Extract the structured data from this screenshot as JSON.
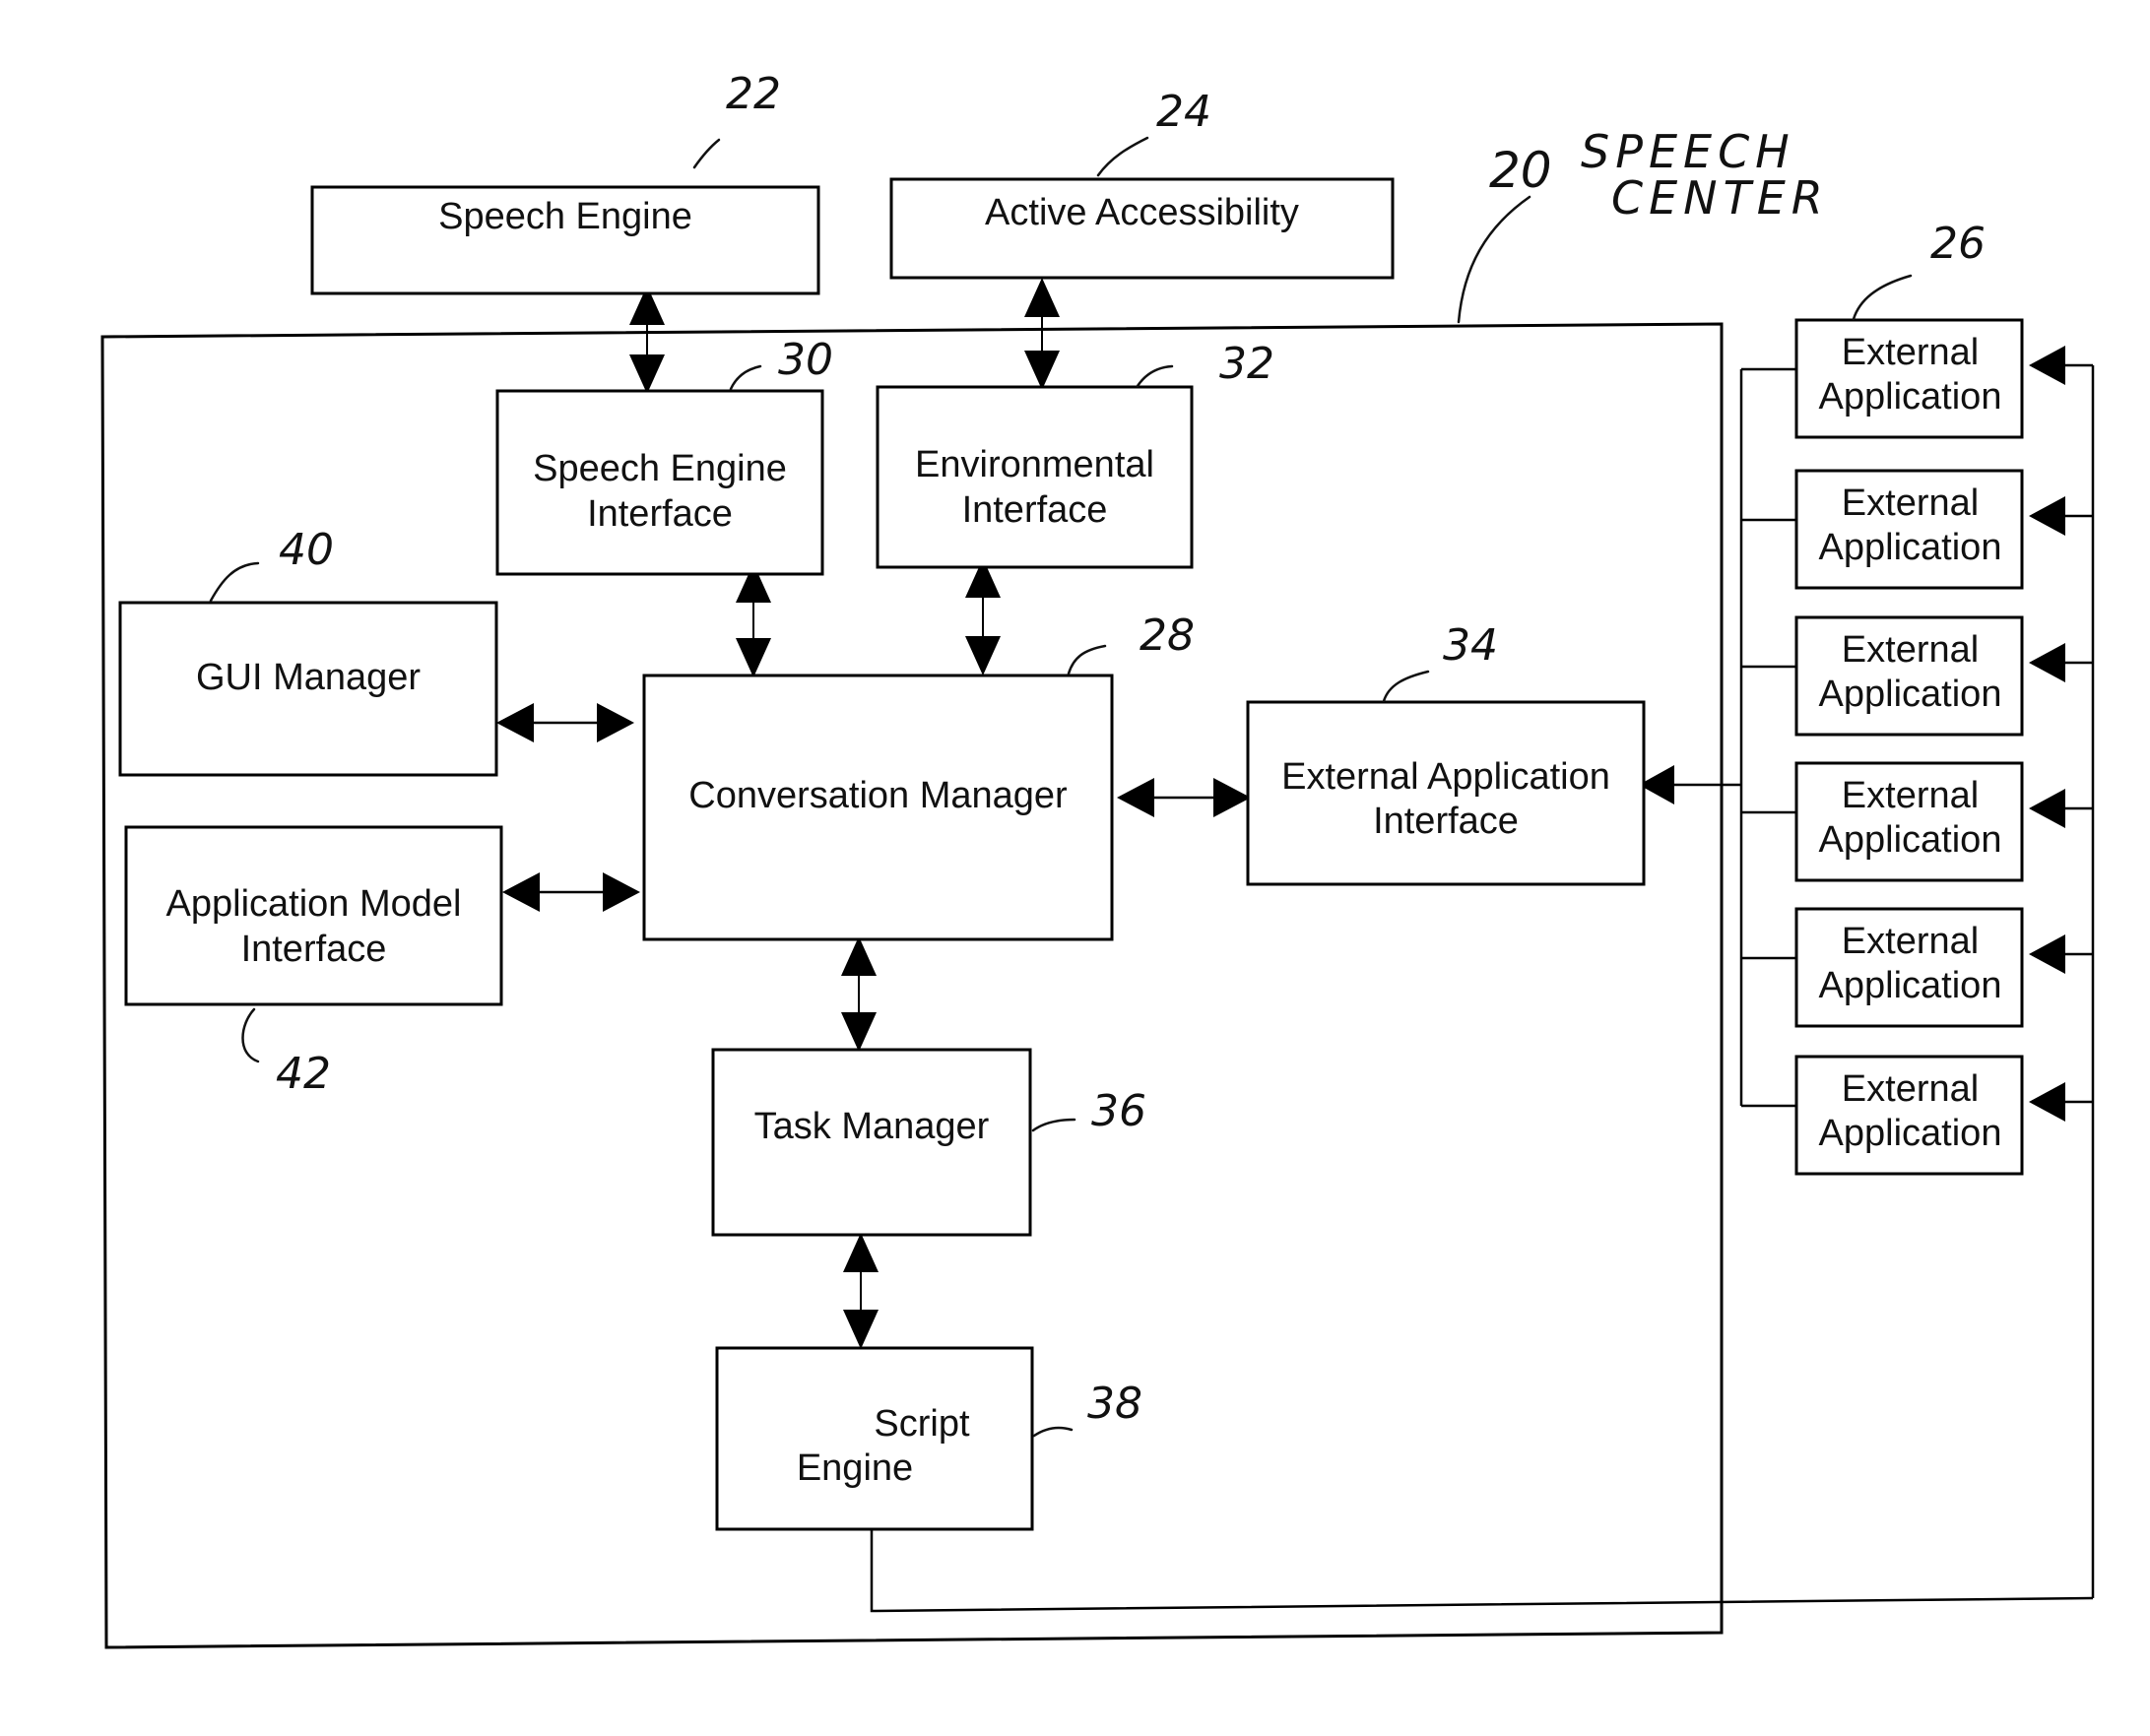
{
  "figure": {
    "type": "block-diagram",
    "system": {
      "ref": "20",
      "label_line1": "SPEECH",
      "label_line2": "CENTER"
    },
    "blocks": {
      "speech_engine": {
        "ref": "22",
        "lines": [
          "Speech Engine"
        ]
      },
      "active_accessibility": {
        "ref": "24",
        "lines": [
          "Active Accessibility"
        ]
      },
      "speech_engine_interface": {
        "ref": "30",
        "lines": [
          "Speech Engine",
          "Interface"
        ]
      },
      "environmental_interface": {
        "ref": "32",
        "lines": [
          "Environmental",
          "Interface"
        ]
      },
      "gui_manager": {
        "ref": "40",
        "lines": [
          "GUI Manager"
        ]
      },
      "application_model_interface": {
        "ref": "42",
        "lines": [
          "Application Model",
          "Interface"
        ]
      },
      "conversation_manager": {
        "ref": "28",
        "lines": [
          "Conversation Manager"
        ]
      },
      "external_application_interface": {
        "ref": "34",
        "lines": [
          "External Application",
          "Interface"
        ]
      },
      "task_manager": {
        "ref": "36",
        "lines": [
          "Task Manager"
        ]
      },
      "script_engine": {
        "ref": "38",
        "lines": [
          "Script",
          "Engine"
        ]
      }
    },
    "external_applications": {
      "ref": "26",
      "count": 6,
      "lines": [
        "External",
        "Application"
      ]
    },
    "connections": [
      {
        "from": "speech_engine",
        "to": "speech_engine_interface",
        "type": "bidirectional"
      },
      {
        "from": "active_accessibility",
        "to": "environmental_interface",
        "type": "bidirectional"
      },
      {
        "from": "speech_engine_interface",
        "to": "conversation_manager",
        "type": "bidirectional"
      },
      {
        "from": "environmental_interface",
        "to": "conversation_manager",
        "type": "bidirectional"
      },
      {
        "from": "gui_manager",
        "to": "conversation_manager",
        "type": "bidirectional"
      },
      {
        "from": "application_model_interface",
        "to": "conversation_manager",
        "type": "bidirectional"
      },
      {
        "from": "conversation_manager",
        "to": "external_application_interface",
        "type": "bidirectional"
      },
      {
        "from": "conversation_manager",
        "to": "task_manager",
        "type": "bidirectional"
      },
      {
        "from": "task_manager",
        "to": "script_engine",
        "type": "bidirectional"
      },
      {
        "from": "external_applications",
        "to": "external_application_interface",
        "type": "directed"
      },
      {
        "from": "script_engine",
        "to": "external_applications",
        "type": "directed"
      }
    ]
  }
}
